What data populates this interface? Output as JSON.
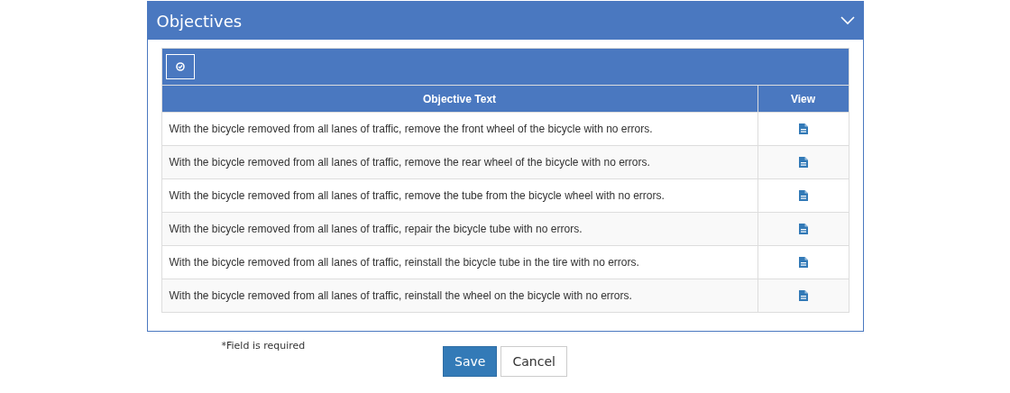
{
  "panel": {
    "title": "Objectives",
    "expanded": true
  },
  "table": {
    "columns": [
      "Objective Text",
      "View"
    ],
    "rows": [
      {
        "text": "With the bicycle removed from all lanes of traffic, remove the front wheel of the bicycle with no errors."
      },
      {
        "text": "With the bicycle removed from all lanes of traffic, remove the rear wheel of the bicycle with no errors."
      },
      {
        "text": "With the bicycle removed from all lanes of traffic, remove the tube from the bicycle wheel with no errors."
      },
      {
        "text": "With the bicycle removed from all lanes of traffic, repair the bicycle tube with no errors."
      },
      {
        "text": "With the bicycle removed from all lanes of traffic, reinstall the bicycle tube in the tire with no errors."
      },
      {
        "text": "With the bicycle removed from all lanes of traffic, reinstall the wheel on the bicycle with no errors."
      }
    ]
  },
  "footer": {
    "note": "*Field is required",
    "buttons": [
      {
        "label": "Save",
        "kind": "primary"
      },
      {
        "label": "Cancel",
        "kind": "default"
      }
    ]
  }
}
